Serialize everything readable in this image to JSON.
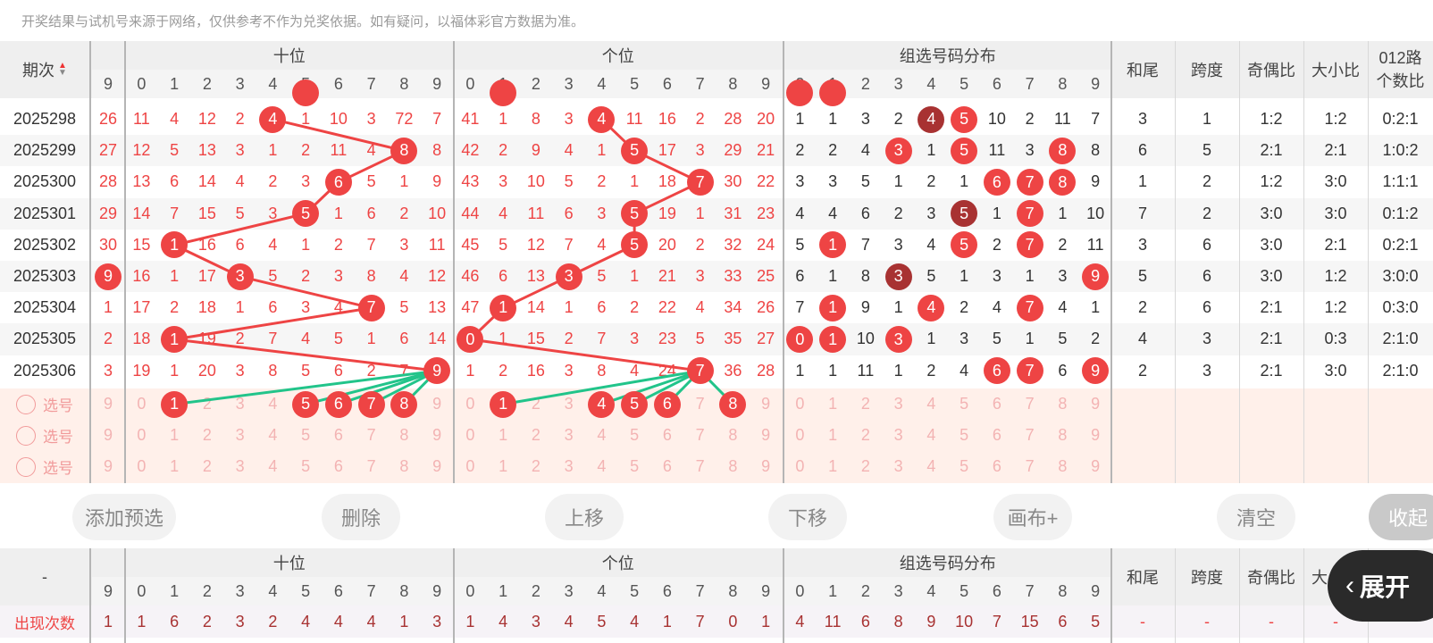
{
  "notice": "开奖结果与试机号来源于网络，仅供参考不作为兑奖依据。如有疑问，以福体彩官方数据为准。",
  "columns": {
    "issue": "期次",
    "miss_first": "9",
    "tens": "十位",
    "units": "个位",
    "group": "组选号码分布",
    "digits": [
      "0",
      "1",
      "2",
      "3",
      "4",
      "5",
      "6",
      "7",
      "8",
      "9"
    ],
    "sum_tail": "和尾",
    "span": "跨度",
    "odd_even": "奇偶比",
    "big_small": "大小比",
    "road_line1": "012路",
    "road_line2": "个数比"
  },
  "rows": [
    {
      "issue": "2025298",
      "miss": "26",
      "tens": [
        "11",
        "4",
        "12",
        "2",
        "4",
        "1",
        "10",
        "3",
        "72",
        "7"
      ],
      "units": [
        "41",
        "1",
        "8",
        "3",
        "4",
        "11",
        "16",
        "2",
        "28",
        "20"
      ],
      "group": [
        "1",
        "1",
        "3",
        "2",
        "4",
        "5",
        "10",
        "2",
        "11",
        "7"
      ],
      "sum_tail": "3",
      "span": "1",
      "odd_even": "1:2",
      "big_small": "1:2",
      "road": "0:2:1"
    },
    {
      "issue": "2025299",
      "miss": "27",
      "tens": [
        "12",
        "5",
        "13",
        "3",
        "1",
        "2",
        "11",
        "4",
        "8",
        "8"
      ],
      "units": [
        "42",
        "2",
        "9",
        "4",
        "1",
        "5",
        "17",
        "3",
        "29",
        "21"
      ],
      "group": [
        "2",
        "2",
        "4",
        "3",
        "1",
        "5",
        "11",
        "3",
        "8",
        "8"
      ],
      "sum_tail": "6",
      "span": "5",
      "odd_even": "2:1",
      "big_small": "2:1",
      "road": "1:0:2"
    },
    {
      "issue": "2025300",
      "miss": "28",
      "tens": [
        "13",
        "6",
        "14",
        "4",
        "2",
        "3",
        "6",
        "5",
        "1",
        "9"
      ],
      "units": [
        "43",
        "3",
        "10",
        "5",
        "2",
        "1",
        "18",
        "7",
        "30",
        "22"
      ],
      "group": [
        "3",
        "3",
        "5",
        "1",
        "2",
        "1",
        "6",
        "7",
        "8",
        "9"
      ],
      "sum_tail": "1",
      "span": "2",
      "odd_even": "1:2",
      "big_small": "3:0",
      "road": "1:1:1"
    },
    {
      "issue": "2025301",
      "miss": "29",
      "tens": [
        "14",
        "7",
        "15",
        "5",
        "3",
        "5",
        "1",
        "6",
        "2",
        "10"
      ],
      "units": [
        "44",
        "4",
        "11",
        "6",
        "3",
        "5",
        "19",
        "1",
        "31",
        "23"
      ],
      "group": [
        "4",
        "4",
        "6",
        "2",
        "3",
        "5",
        "1",
        "7",
        "1",
        "10"
      ],
      "sum_tail": "7",
      "span": "2",
      "odd_even": "3:0",
      "big_small": "3:0",
      "road": "0:1:2"
    },
    {
      "issue": "2025302",
      "miss": "30",
      "tens": [
        "15",
        "1",
        "16",
        "6",
        "4",
        "1",
        "2",
        "7",
        "3",
        "11"
      ],
      "units": [
        "45",
        "5",
        "12",
        "7",
        "4",
        "5",
        "20",
        "2",
        "32",
        "24"
      ],
      "group": [
        "5",
        "1",
        "7",
        "3",
        "4",
        "5",
        "2",
        "7",
        "2",
        "11"
      ],
      "sum_tail": "3",
      "span": "6",
      "odd_even": "3:0",
      "big_small": "2:1",
      "road": "0:2:1"
    },
    {
      "issue": "2025303",
      "miss": "9",
      "tens": [
        "16",
        "1",
        "17",
        "3",
        "5",
        "2",
        "3",
        "8",
        "4",
        "12"
      ],
      "units": [
        "46",
        "6",
        "13",
        "3",
        "5",
        "1",
        "21",
        "3",
        "33",
        "25"
      ],
      "group": [
        "6",
        "1",
        "8",
        "3",
        "5",
        "1",
        "3",
        "1",
        "3",
        "9"
      ],
      "sum_tail": "5",
      "span": "6",
      "odd_even": "3:0",
      "big_small": "1:2",
      "road": "3:0:0"
    },
    {
      "issue": "2025304",
      "miss": "1",
      "tens": [
        "17",
        "2",
        "18",
        "1",
        "6",
        "3",
        "4",
        "7",
        "5",
        "13"
      ],
      "units": [
        "47",
        "1",
        "14",
        "1",
        "6",
        "2",
        "22",
        "4",
        "34",
        "26"
      ],
      "group": [
        "7",
        "1",
        "9",
        "1",
        "4",
        "2",
        "4",
        "7",
        "4",
        "1"
      ],
      "sum_tail": "2",
      "span": "6",
      "odd_even": "2:1",
      "big_small": "1:2",
      "road": "0:3:0"
    },
    {
      "issue": "2025305",
      "miss": "2",
      "tens": [
        "18",
        "1",
        "19",
        "2",
        "7",
        "4",
        "5",
        "1",
        "6",
        "14"
      ],
      "units": [
        "0",
        "1",
        "15",
        "2",
        "7",
        "3",
        "23",
        "5",
        "35",
        "27"
      ],
      "group": [
        "0",
        "1",
        "10",
        "3",
        "1",
        "3",
        "5",
        "1",
        "5",
        "2"
      ],
      "sum_tail": "4",
      "span": "3",
      "odd_even": "2:1",
      "big_small": "0:3",
      "road": "2:1:0"
    },
    {
      "issue": "2025306",
      "miss": "3",
      "tens": [
        "19",
        "1",
        "20",
        "3",
        "8",
        "5",
        "6",
        "2",
        "7",
        "9"
      ],
      "units": [
        "1",
        "2",
        "16",
        "3",
        "8",
        "4",
        "24",
        "7",
        "36",
        "28"
      ],
      "group": [
        "1",
        "1",
        "11",
        "1",
        "2",
        "4",
        "6",
        "7",
        "6",
        "9"
      ],
      "sum_tail": "2",
      "span": "3",
      "odd_even": "2:1",
      "big_small": "3:0",
      "road": "2:1:0"
    }
  ],
  "select_label": "选号",
  "buttons": {
    "add": "添加预选",
    "delete": "删除",
    "up": "上移",
    "down": "下移",
    "canvas": "画布+",
    "clear": "清空",
    "collapse": "收起"
  },
  "footer": {
    "dash": "-",
    "count_label": "出现次数",
    "miss_count": "1",
    "tens_counts": [
      "1",
      "6",
      "2",
      "3",
      "2",
      "4",
      "4",
      "4",
      "1",
      "3"
    ],
    "units_counts": [
      "1",
      "4",
      "3",
      "4",
      "5",
      "4",
      "1",
      "7",
      "0",
      "1"
    ],
    "group_counts": [
      "4",
      "11",
      "6",
      "8",
      "9",
      "10",
      "7",
      "15",
      "6",
      "5"
    ],
    "stat_dash": "-"
  },
  "expand_label": "展开",
  "colors": {
    "red": "#ee4444",
    "dark_red": "#a83232",
    "green": "#22c48a",
    "pink": "#fff0ea"
  }
}
